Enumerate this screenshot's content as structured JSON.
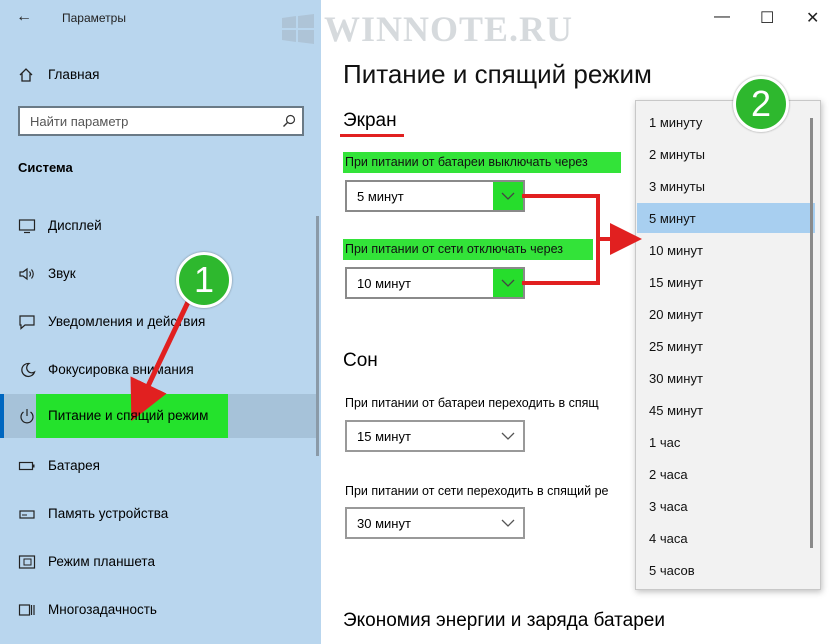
{
  "window": {
    "title": "Параметры",
    "back_glyph": "←",
    "minimize_glyph": "—",
    "maximize_glyph": "☐",
    "close_glyph": "✕"
  },
  "watermark": "WINNOTE.RU",
  "sidebar": {
    "home_label": "Главная",
    "search_placeholder": "Найти параметр",
    "section_title": "Система",
    "items": [
      {
        "label": "Дисплей",
        "icon": "display-icon"
      },
      {
        "label": "Звук",
        "icon": "sound-icon"
      },
      {
        "label": "Уведомления и действия",
        "icon": "notifications-icon"
      },
      {
        "label": "Фокусировка внимания",
        "icon": "focus-assist-icon"
      },
      {
        "label": "Питание и спящий режим",
        "icon": "power-icon",
        "active": true
      },
      {
        "label": "Батарея",
        "icon": "battery-icon"
      },
      {
        "label": "Память устройства",
        "icon": "storage-icon"
      },
      {
        "label": "Режим планшета",
        "icon": "tablet-icon"
      },
      {
        "label": "Многозадачность",
        "icon": "multitasking-icon"
      }
    ]
  },
  "main": {
    "title": "Питание и спящий режим",
    "screen": {
      "heading": "Экран",
      "battery_label": "При питании от батареи выключать через",
      "battery_value": "5 минут",
      "ac_label": "При питании от сети отключать через",
      "ac_value": "10 минут"
    },
    "sleep": {
      "heading": "Сон",
      "battery_label": "При питании от батареи переходить в спящ",
      "battery_value": "15 минут",
      "ac_label": "При питании от сети переходить в спящий ре",
      "ac_value": "30 минут"
    },
    "eco_heading": "Экономия энергии и заряда батареи"
  },
  "dropdown": {
    "options": [
      "1 минуту",
      "2 минуты",
      "3 минуты",
      "5 минут",
      "10 минут",
      "15 минут",
      "20 минут",
      "25 минут",
      "30 минут",
      "45 минут",
      "1 час",
      "2 часа",
      "3 часа",
      "4 часа",
      "5 часов"
    ],
    "selected": "5 минут"
  },
  "badges": {
    "one": "1",
    "two": "2"
  },
  "colors": {
    "sidebar_bg": "#b9d6ee",
    "highlight_green": "#33e339",
    "annotation_red": "#e12020",
    "badge_green": "#2eb82e",
    "selected_option": "#a8cff0"
  }
}
